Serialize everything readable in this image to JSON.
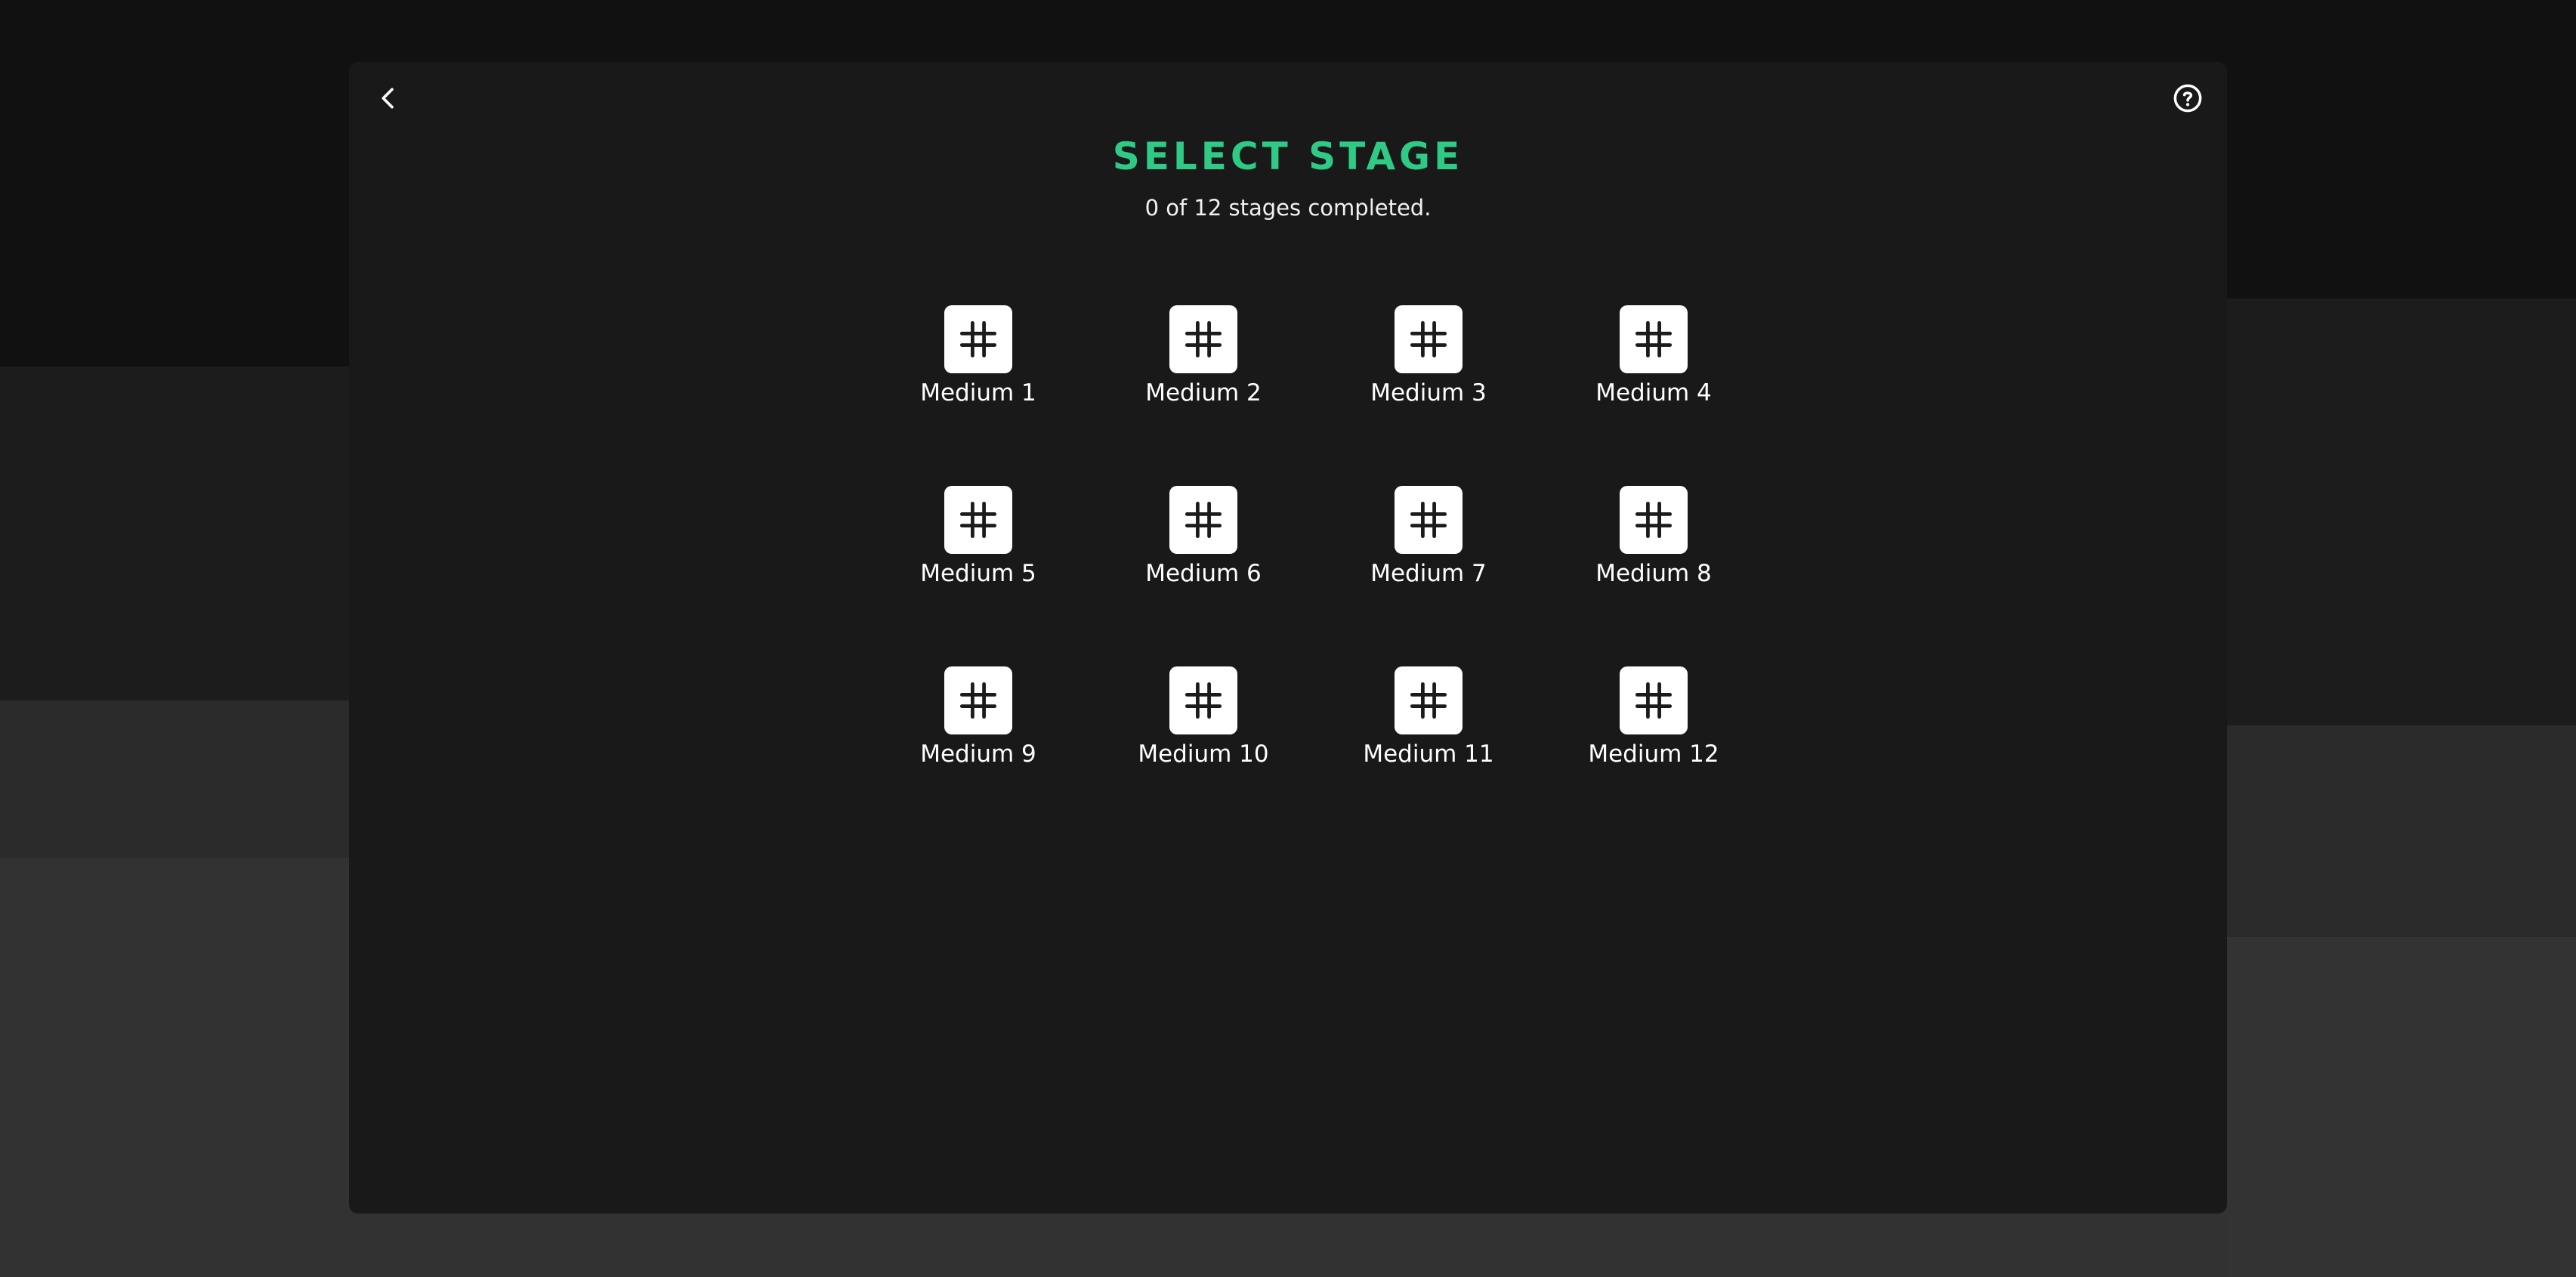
{
  "header": {
    "back_icon": "chevron-left-icon",
    "help_icon": "question-circle-icon",
    "title": "SELECT STAGE",
    "progress_text": "0 of 12 stages completed."
  },
  "colors": {
    "accent": "#2fcb86",
    "panel": "#191919",
    "tile": "#ffffff"
  },
  "progress": {
    "completed": 0,
    "total": 12
  },
  "stages": [
    {
      "label": "Medium 1",
      "icon": "grid-hash-icon"
    },
    {
      "label": "Medium 2",
      "icon": "grid-hash-icon"
    },
    {
      "label": "Medium 3",
      "icon": "grid-hash-icon"
    },
    {
      "label": "Medium 4",
      "icon": "grid-hash-icon"
    },
    {
      "label": "Medium 5",
      "icon": "grid-hash-icon"
    },
    {
      "label": "Medium 6",
      "icon": "grid-hash-icon"
    },
    {
      "label": "Medium 7",
      "icon": "grid-hash-icon"
    },
    {
      "label": "Medium 8",
      "icon": "grid-hash-icon"
    },
    {
      "label": "Medium 9",
      "icon": "grid-hash-icon"
    },
    {
      "label": "Medium 10",
      "icon": "grid-hash-icon"
    },
    {
      "label": "Medium 11",
      "icon": "grid-hash-icon"
    },
    {
      "label": "Medium 12",
      "icon": "grid-hash-icon"
    }
  ]
}
